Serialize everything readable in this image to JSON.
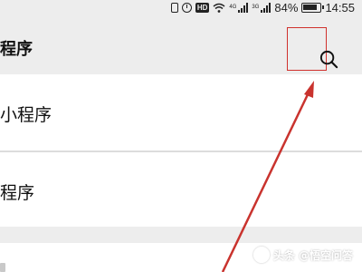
{
  "status_bar": {
    "signal_1_tag": "4G",
    "signal_2_tag": "3G",
    "hd_label": "HD",
    "battery_percent": "84%",
    "time": "14:55"
  },
  "header": {
    "title": "程序",
    "search_icon": "search-icon",
    "highlight_color": "#d0312d"
  },
  "list": {
    "items": [
      {
        "label": "小程序"
      },
      {
        "label": "程序"
      }
    ]
  },
  "annotation": {
    "type": "red-arrow",
    "color": "#c9332e",
    "points_to": "search-button"
  },
  "watermark": {
    "text": "头条 @悟空问答"
  }
}
